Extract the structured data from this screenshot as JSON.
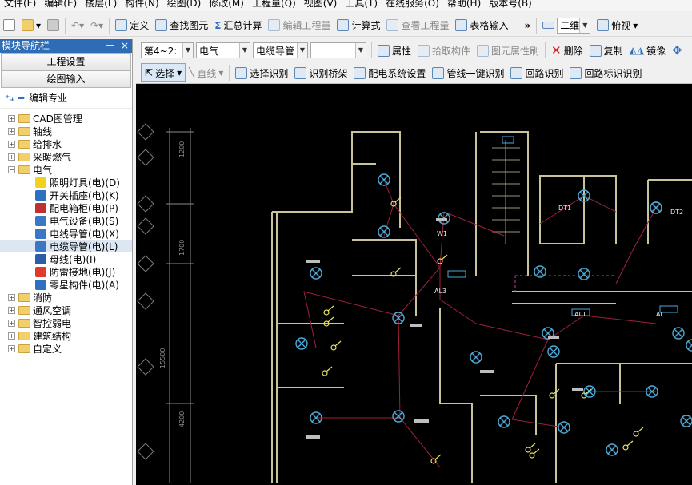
{
  "menu": [
    "文件(F)",
    "编辑(E)",
    "楼层(L)",
    "构件(N)",
    "绘图(D)",
    "修改(M)",
    "工程量(Q)",
    "视图(V)",
    "工具(T)",
    "在线服务(O)",
    "帮助(H)",
    "版本号(B)"
  ],
  "toolbar1": {
    "define": "定义",
    "find_element": "查找图元",
    "summary_calc": "汇总计算",
    "edit_quantity": "编辑工程量",
    "formula": "计算式",
    "view_quantity": "查看工程量",
    "table_input": "表格输入",
    "more": "»",
    "view_mode": "二维",
    "view_dir": "俯视"
  },
  "sidebar": {
    "title": "模块导航栏",
    "pin": "ᅲ",
    "close": "×",
    "btn_project": "工程设置",
    "btn_draw": "绘图输入",
    "edit_spec": "编辑专业",
    "tree": [
      {
        "label": "CAD图管理",
        "expanded": false
      },
      {
        "label": "轴线",
        "expanded": false
      },
      {
        "label": "给排水",
        "expanded": false
      },
      {
        "label": "采暖燃气",
        "expanded": false
      },
      {
        "label": "电气",
        "expanded": true,
        "children": [
          {
            "label": "照明灯具(电)(D)",
            "icon": "bulb-icon",
            "color": "#f2d21f"
          },
          {
            "label": "开关插座(电)(K)",
            "icon": "switch-icon",
            "color": "#2f6fc0"
          },
          {
            "label": "配电箱柜(电)(P)",
            "icon": "cabinet-icon",
            "color": "#c03030"
          },
          {
            "label": "电气设备(电)(S)",
            "icon": "device-icon",
            "color": "#3a77c4"
          },
          {
            "label": "电线导管(电)(X)",
            "icon": "wire-icon",
            "color": "#3a77c4"
          },
          {
            "label": "电缆导管(电)(L)",
            "icon": "cable-icon",
            "color": "#3a77c4",
            "selected": true
          },
          {
            "label": "母线(电)(I)",
            "icon": "busbar-icon",
            "color": "#2c5ca8"
          },
          {
            "label": "防雷接地(电)(J)",
            "icon": "lightning-icon",
            "color": "#e03a2a"
          },
          {
            "label": "零星构件(电)(A)",
            "icon": "grid-icon",
            "color": "#2f6fc0"
          }
        ]
      },
      {
        "label": "消防",
        "expanded": false
      },
      {
        "label": "通风空调",
        "expanded": false
      },
      {
        "label": "智控弱电",
        "expanded": false
      },
      {
        "label": "建筑结构",
        "expanded": false
      },
      {
        "label": "自定义",
        "expanded": false
      }
    ]
  },
  "toolbar2": {
    "floor": "第4~2:",
    "discipline": "电气",
    "element_type": "电缆导管",
    "element_name": "",
    "property": "属性",
    "pick_element": "拾取构件",
    "element_property": "图元属性刷",
    "delete": "删除",
    "copy": "复制",
    "mirror": "镜像"
  },
  "toolbar3": {
    "select": "选择",
    "line": "直线",
    "select_identify": "选择识别",
    "bridge_identify": "识别桥架",
    "distribution_setting": "配电系统设置",
    "conduit_one_key": "管线一键识别",
    "loop_identify": "回路识别",
    "loop_label_identify": "回路标识识别"
  },
  "drawing": {
    "dims": [
      "1200",
      "1700",
      "15500",
      "4200"
    ],
    "labels": [
      "AL3",
      "AL1",
      "AL1",
      "DT1",
      "DT2",
      "W1"
    ]
  }
}
